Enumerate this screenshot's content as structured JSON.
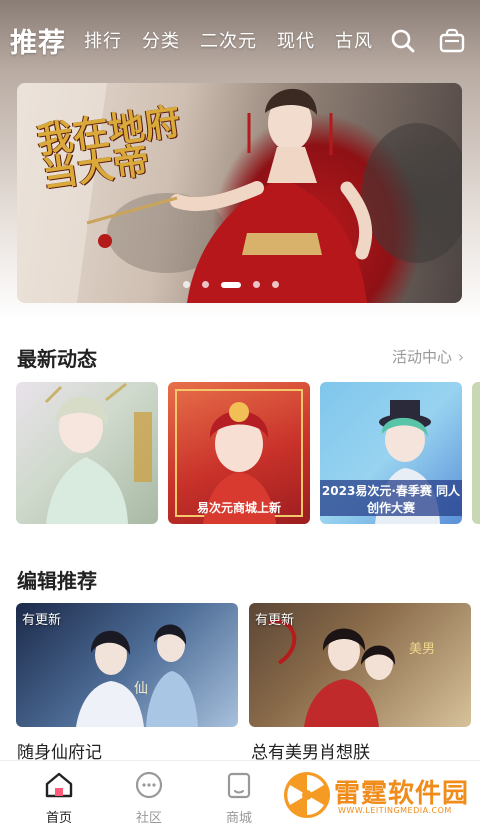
{
  "nav": {
    "tabs": [
      {
        "label": "推荐"
      },
      {
        "label": "排行"
      },
      {
        "label": "分类"
      },
      {
        "label": "二次元"
      },
      {
        "label": "现代"
      },
      {
        "label": "古风"
      }
    ],
    "search_icon": "search-icon",
    "bag_icon": "shopping-bag-icon"
  },
  "banner": {
    "title": "我在地府当大帝",
    "total_slides": 5,
    "active_slide": 3
  },
  "latest": {
    "title": "最新动态",
    "more_label": "活动中心",
    "cards": [
      {
        "caption": ""
      },
      {
        "caption": "易次元商城上新"
      },
      {
        "caption": "2023易次元·春季赛 同人创作大赛"
      }
    ]
  },
  "editor": {
    "title": "编辑推荐",
    "items": [
      {
        "badge": "有更新",
        "name": "随身仙府记"
      },
      {
        "badge": "有更新",
        "name": "总有美男肖想朕"
      }
    ]
  },
  "tabbar": {
    "items": [
      {
        "label": "首页",
        "icon": "home-icon"
      },
      {
        "label": "社区",
        "icon": "community-icon"
      },
      {
        "label": "商城",
        "icon": "store-icon"
      }
    ]
  },
  "watermark": {
    "text": "雷霆软件园",
    "url": "WWW.LEITINGMEDIA.COM"
  },
  "colors": {
    "accent": "#ff5a78",
    "watermark": "#f08c1a",
    "banner_red": "#b7191c"
  }
}
